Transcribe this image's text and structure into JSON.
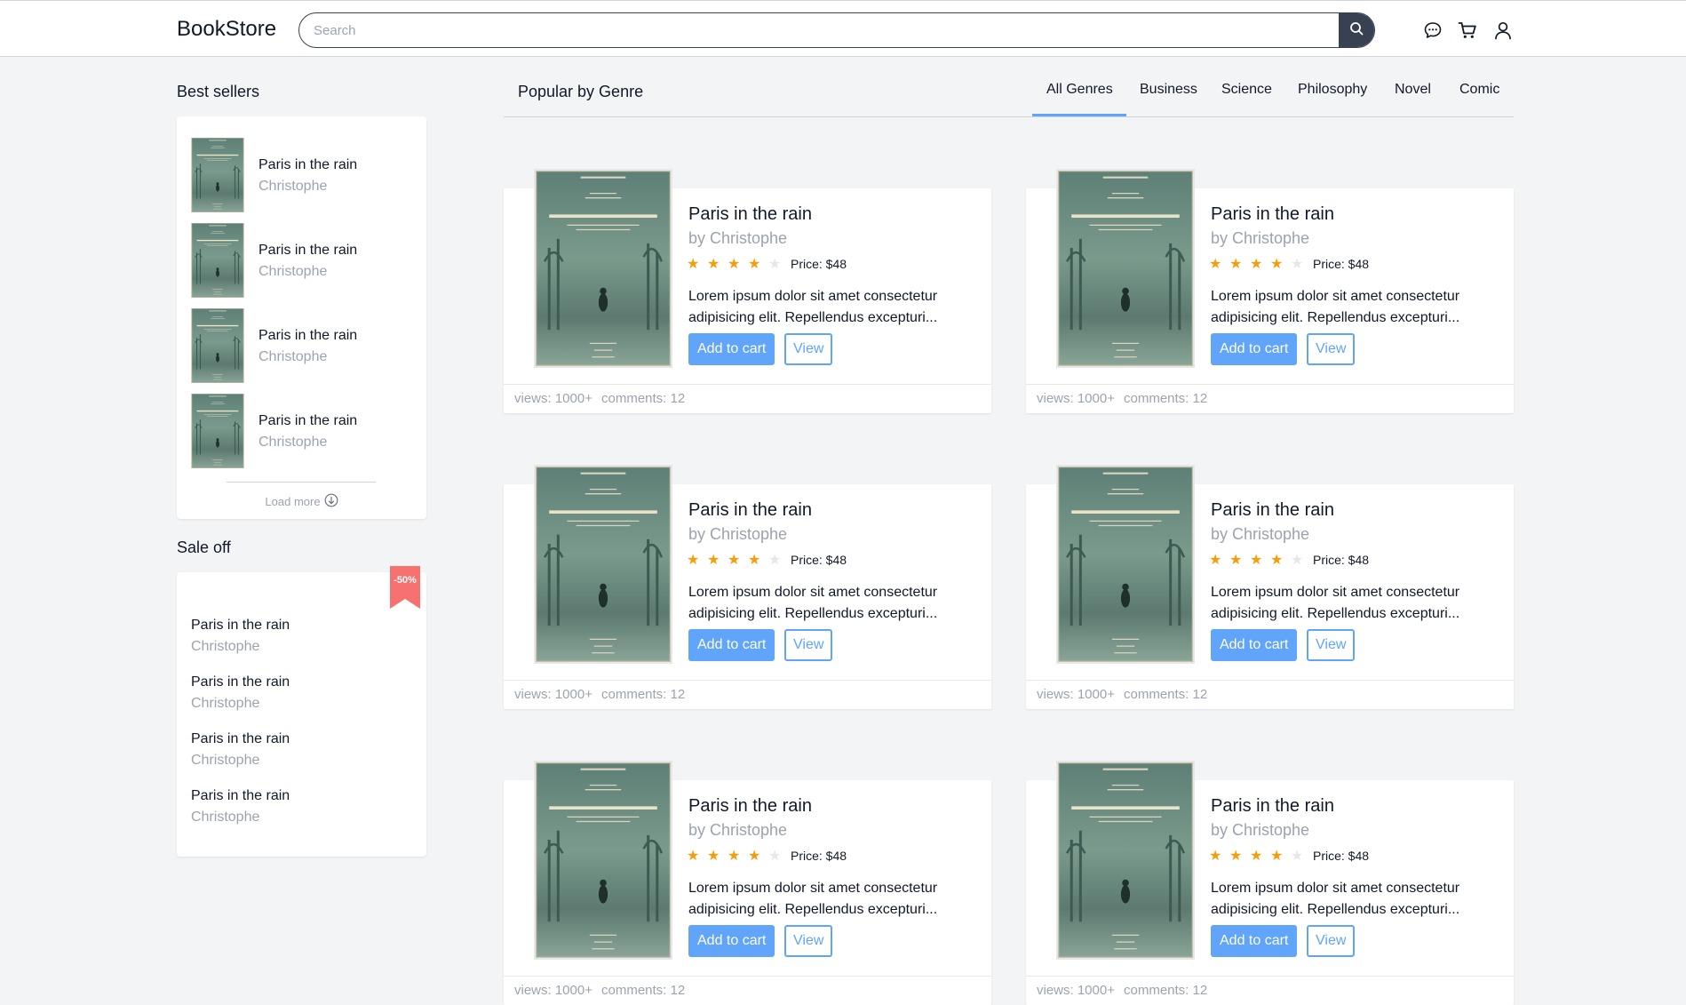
{
  "header": {
    "logo": "BookStore",
    "search_placeholder": "Search"
  },
  "sidebar": {
    "best_sellers_title": "Best sellers",
    "best_sellers": [
      {
        "title": "Paris in the rain",
        "author": "Christophe"
      },
      {
        "title": "Paris in the rain",
        "author": "Christophe"
      },
      {
        "title": "Paris in the rain",
        "author": "Christophe"
      },
      {
        "title": "Paris in the rain",
        "author": "Christophe"
      }
    ],
    "load_more": "Load more",
    "sale_title": "Sale off",
    "sale_badge": "-50%",
    "sale_items": [
      {
        "title": "Paris in the rain",
        "author": "Christophe"
      },
      {
        "title": "Paris in the rain",
        "author": "Christophe"
      },
      {
        "title": "Paris in the rain",
        "author": "Christophe"
      },
      {
        "title": "Paris in the rain",
        "author": "Christophe"
      }
    ]
  },
  "main": {
    "title": "Popular by Genre",
    "tabs": [
      "All Genres",
      "Business",
      "Science",
      "Philosophy",
      "Novel",
      "Comic"
    ],
    "active_tab": "All Genres",
    "books": [
      {
        "title": "Paris in the rain",
        "author": "by Christophe",
        "rating": 4,
        "price": "Price: $48",
        "desc": "Lorem ipsum dolor sit amet consectetur adipisicing elit. Repellendus excepturi...",
        "add_label": "Add to cart",
        "view_label": "View",
        "views": "views: 1000+",
        "comments": "comments: 12"
      },
      {
        "title": "Paris in the rain",
        "author": "by Christophe",
        "rating": 4,
        "price": "Price: $48",
        "desc": "Lorem ipsum dolor sit amet consectetur adipisicing elit. Repellendus excepturi...",
        "add_label": "Add to cart",
        "view_label": "View",
        "views": "views: 1000+",
        "comments": "comments: 12"
      },
      {
        "title": "Paris in the rain",
        "author": "by Christophe",
        "rating": 4,
        "price": "Price: $48",
        "desc": "Lorem ipsum dolor sit amet consectetur adipisicing elit. Repellendus excepturi...",
        "add_label": "Add to cart",
        "view_label": "View",
        "views": "views: 1000+",
        "comments": "comments: 12"
      },
      {
        "title": "Paris in the rain",
        "author": "by Christophe",
        "rating": 4,
        "price": "Price: $48",
        "desc": "Lorem ipsum dolor sit amet consectetur adipisicing elit. Repellendus excepturi...",
        "add_label": "Add to cart",
        "view_label": "View",
        "views": "views: 1000+",
        "comments": "comments: 12"
      },
      {
        "title": "Paris in the rain",
        "author": "by Christophe",
        "rating": 4,
        "price": "Price: $48",
        "desc": "Lorem ipsum dolor sit amet consectetur adipisicing elit. Repellendus excepturi...",
        "add_label": "Add to cart",
        "view_label": "View",
        "views": "views: 1000+",
        "comments": "comments: 12"
      },
      {
        "title": "Paris in the rain",
        "author": "by Christophe",
        "rating": 4,
        "price": "Price: $48",
        "desc": "Lorem ipsum dolor sit amet consectetur adipisicing elit. Repellendus excepturi...",
        "add_label": "Add to cart",
        "view_label": "View",
        "views": "views: 1000+",
        "comments": "comments: 12"
      }
    ]
  },
  "colors": {
    "accent": "#60a5fa",
    "star": "#f59e0b",
    "sale_badge": "#f87171",
    "header_button": "#374151",
    "background": "#f3f4f6"
  },
  "icons": {
    "search": "search-icon",
    "chat": "chat-icon",
    "cart": "cart-icon",
    "user": "user-icon",
    "load_more": "arrow-down-circle-icon",
    "sale_badge": "ribbon-icon"
  }
}
